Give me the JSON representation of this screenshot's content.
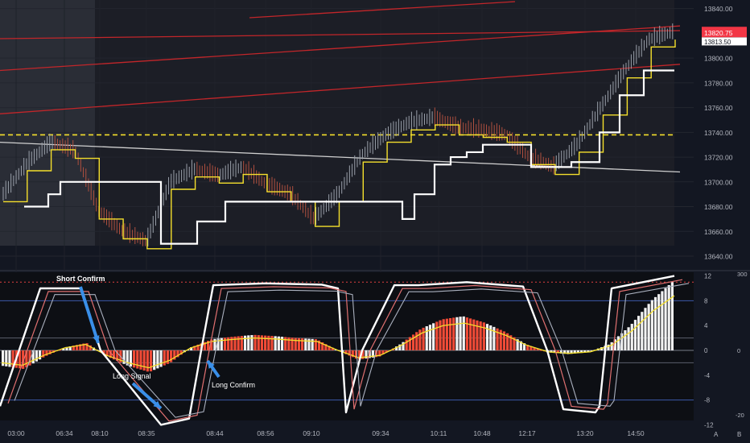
{
  "price_scale": {
    "ticks": [
      "13840.00",
      "13800.00",
      "13780.00",
      "13760.00",
      "13740.00",
      "13720.00",
      "13700.00",
      "13680.00",
      "13660.00",
      "13640.00"
    ],
    "last_price_label": "13820.75",
    "second_price_label": "13813.50",
    "last_price_color": "#f23645"
  },
  "osc_scale": {
    "ticks": [
      "12",
      "8",
      "4",
      "0",
      "-4",
      "-8",
      "-12"
    ],
    "outer_ticks": [
      "300",
      "0",
      "-20"
    ]
  },
  "time_axis": {
    "labels": [
      "03:00",
      "06:34",
      "08:10",
      "08:35",
      "08:44",
      "08:56",
      "09:10",
      "09:34",
      "10:11",
      "10:48",
      "12:17",
      "13:20",
      "14:50"
    ]
  },
  "annotations": {
    "short_confirm": "Short Confirm",
    "long_signal": "Long Signal",
    "long_confirm": "Long Confirm"
  },
  "corner_buttons": {
    "auto": "A",
    "badge": "B"
  },
  "colors": {
    "background": "#131722",
    "red_line": "#c2262a",
    "yellow": "#f5e02c",
    "white": "#ffffff",
    "histogram_red": "#f04b37",
    "histogram_white": "#f2f2f2",
    "arrow_blue": "#3a8fe8"
  },
  "chart_data": [
    {
      "type": "line",
      "title": "",
      "ylim": [
        13640,
        13845
      ],
      "x": [
        "03:00",
        "06:34",
        "08:10",
        "08:35",
        "08:44",
        "08:56",
        "09:10",
        "09:34",
        "10:11",
        "10:48",
        "12:17",
        "13:20",
        "14:50"
      ],
      "horizontal_lines": [
        {
          "name": "",
          "value": 13738,
          "style": "dashed",
          "color": "#f5e02c"
        }
      ],
      "trend_lines": [
        {
          "name": "",
          "from": [
            "start",
            13790
          ],
          "to": [
            "end",
            13826
          ],
          "color": "#c2262a"
        },
        {
          "name": "",
          "from": [
            "start",
            13755
          ],
          "to": [
            "end",
            13795
          ],
          "color": "#c2262a"
        },
        {
          "name": "",
          "from": [
            "start",
            13732
          ],
          "to": [
            "end",
            13708
          ],
          "color": "#d0d0d0"
        }
      ],
      "series": [
        {
          "name": "",
          "values": [
            13690,
            13715,
            13732,
            13725,
            13676,
            13660,
            13652,
            13700,
            13710,
            13705,
            13712,
            13698,
            13690,
            13670,
            13690,
            13722,
            13738,
            13748,
            13752,
            13744,
            13742,
            13738,
            13720,
            13712,
            13730,
            13760,
            13790,
            13815,
            13821
          ]
        },
        {
          "name": "",
          "values": [
            13680,
            13690,
            13700,
            13700,
            13650,
            13650,
            13668,
            13684,
            13684,
            13684,
            13684,
            13670,
            13690,
            13714,
            13720,
            13724,
            13730,
            13730,
            13712,
            13712,
            13716,
            13740,
            13770,
            13790
          ]
        }
      ]
    },
    {
      "type": "bar",
      "title": "",
      "ylim": [
        -12,
        12
      ],
      "x": [
        "03:00",
        "06:34",
        "08:10",
        "08:35",
        "08:44",
        "08:56",
        "09:10",
        "09:34",
        "10:11",
        "10:48",
        "12:17",
        "13:20",
        "14:50"
      ],
      "reference_lines": [
        11,
        8,
        2,
        -2,
        -8
      ],
      "series": [
        {
          "name": "",
          "values": [
            -2.5,
            -3,
            -1,
            0.5,
            1.2,
            -1,
            -2.5,
            -3.5,
            -2,
            0.5,
            1.8,
            2.2,
            2.5,
            2.3,
            2,
            1.8,
            0,
            -1.5,
            -1,
            1,
            3.5,
            5,
            5.5,
            4.5,
            3,
            1,
            -0.3,
            -0.6,
            -0.3,
            1,
            4,
            8,
            11
          ]
        },
        {
          "name": "",
          "values": [
            -9,
            10,
            10,
            0,
            -12,
            -11,
            0,
            10.5,
            10.8,
            10.6,
            10,
            -10,
            0,
            10.5,
            10.5,
            11,
            10.3,
            0,
            -9.5,
            -10,
            -9,
            10,
            12
          ]
        }
      ]
    }
  ]
}
